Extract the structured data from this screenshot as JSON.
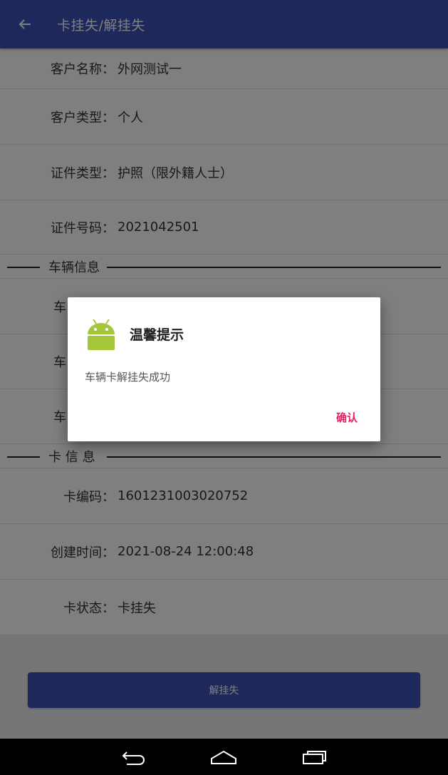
{
  "appbar": {
    "title": "卡挂失/解挂失",
    "back_icon": "arrow-left-icon"
  },
  "customer": {
    "name_label": "客户名称：",
    "name_value": "外网测试一",
    "type_label": "客户类型：",
    "type_value": "个人",
    "id_type_label": "证件类型：",
    "id_type_value": "护照（限外籍人士）",
    "id_no_label": "证件号码：",
    "id_no_value": "2021042501"
  },
  "vehicle_section": {
    "title": "车辆信息",
    "row_labels": [
      "车",
      "车",
      "车"
    ]
  },
  "card_section": {
    "title": "卡 信 息",
    "card_no_label": "卡编码：",
    "card_no_value": "1601231003020752",
    "created_label": "创建时间：",
    "created_value": "2021-08-24 12:00:48",
    "status_label": "卡状态：",
    "status_value": "卡挂失"
  },
  "submit_button": {
    "label": "解挂失"
  },
  "dialog": {
    "icon": "android-icon",
    "title": "温馨提示",
    "message": "车辆卡解挂失成功",
    "confirm_label": "确认"
  },
  "navbar": {
    "icons": [
      "back-nav-icon",
      "home-nav-icon",
      "recents-nav-icon"
    ]
  },
  "colors": {
    "primary": "#3f51b5",
    "accent": "#e91e63",
    "android_green": "#a4c639"
  }
}
